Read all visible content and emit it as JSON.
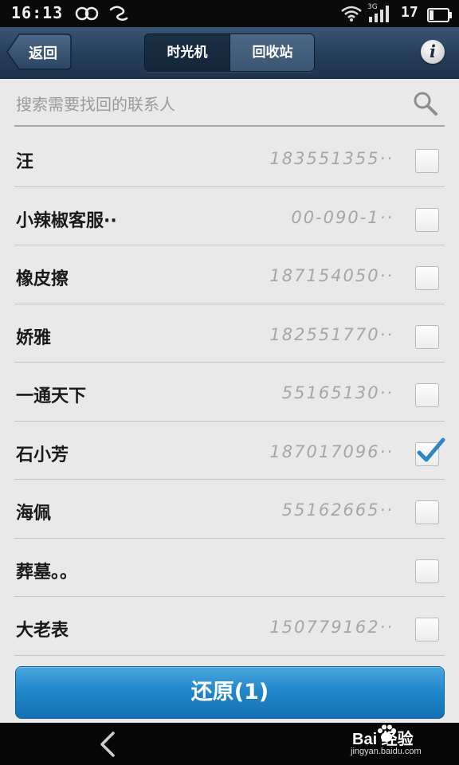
{
  "status_bar": {
    "time": "16:13",
    "network": "3G",
    "battery": "17"
  },
  "header": {
    "back_label": "返回",
    "tabs": [
      {
        "label": "时光机",
        "active": false
      },
      {
        "label": "回收站",
        "active": true
      }
    ],
    "info_label": "i"
  },
  "search": {
    "placeholder": "搜索需要找回的联系人",
    "value": ""
  },
  "contacts": [
    {
      "name": "汪",
      "phone": "183551355··",
      "checked": false
    },
    {
      "name": "小辣椒客服··",
      "phone": "00-090-1··",
      "checked": false
    },
    {
      "name": "橡皮擦",
      "phone": "187154050··",
      "checked": false
    },
    {
      "name": "娇雅",
      "phone": "182551770··",
      "checked": false
    },
    {
      "name": "一通天下",
      "phone": "55165130··",
      "checked": false
    },
    {
      "name": "石小芳",
      "phone": "187017096··",
      "checked": true
    },
    {
      "name": "海佩",
      "phone": "55162665··",
      "checked": false
    },
    {
      "name": "葬墓。。",
      "phone": "",
      "checked": false
    },
    {
      "name": "大老表",
      "phone": "150779162··",
      "checked": false
    }
  ],
  "restore_button": {
    "label": "还原(1)"
  },
  "watermark": {
    "brand": "Bai 经验",
    "url": "jingyan.baidu.com"
  },
  "colors": {
    "header": "#2c4562",
    "accent": "#1f86c8",
    "check": "#2f86c5"
  }
}
